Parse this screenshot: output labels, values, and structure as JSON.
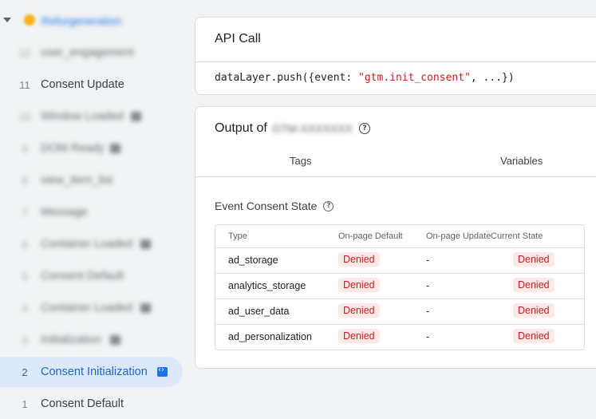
{
  "sidebar": {
    "site_name": "Refurgeneration",
    "items": [
      {
        "num": "12",
        "label": "user_engagement",
        "blurred": true
      },
      {
        "num": "11",
        "label": "Consent Update",
        "blurred": false
      },
      {
        "num": "10",
        "label": "Window Loaded",
        "blurred": true,
        "badge": "gray"
      },
      {
        "num": "9",
        "label": "DOM Ready",
        "blurred": true,
        "badge": "gray"
      },
      {
        "num": "8",
        "label": "view_item_list",
        "blurred": true
      },
      {
        "num": "7",
        "label": "Message",
        "blurred": true
      },
      {
        "num": "6",
        "label": "Container Loaded",
        "blurred": true,
        "badge": "gray"
      },
      {
        "num": "5",
        "label": "Consent Default",
        "blurred": true
      },
      {
        "num": "4",
        "label": "Container Loaded",
        "blurred": true,
        "badge": "gray"
      },
      {
        "num": "3",
        "label": "Initialization",
        "blurred": true,
        "badge": "gray"
      },
      {
        "num": "2",
        "label": "Consent Initialization",
        "blurred": false,
        "active": true,
        "badge": "blue"
      },
      {
        "num": "1",
        "label": "Consent Default",
        "blurred": false
      }
    ]
  },
  "api_call": {
    "title": "API Call",
    "code_prefix": "dataLayer.push({event: ",
    "code_string": "\"gtm.init_consent\"",
    "code_suffix": ", ...})"
  },
  "output": {
    "title": "Output of",
    "container_id": "GTM-XXXXXXX",
    "tabs": [
      "Tags",
      "Variables"
    ],
    "section_title": "Event Consent State",
    "table": {
      "headers": [
        "Type",
        "On-page Default",
        "On-page Update",
        "Current State"
      ],
      "rows": [
        {
          "type": "ad_storage",
          "default": "Denied",
          "update": "-",
          "current": "Denied"
        },
        {
          "type": "analytics_storage",
          "default": "Denied",
          "update": "-",
          "current": "Denied"
        },
        {
          "type": "ad_user_data",
          "default": "Denied",
          "update": "-",
          "current": "Denied"
        },
        {
          "type": "ad_personalization",
          "default": "Denied",
          "update": "-",
          "current": "Denied"
        }
      ]
    }
  },
  "colors": {
    "accent": "#1a73e8",
    "active_bg": "#dde9fb",
    "denied_bg": "#fce8e6",
    "denied_text": "#c5221f"
  }
}
